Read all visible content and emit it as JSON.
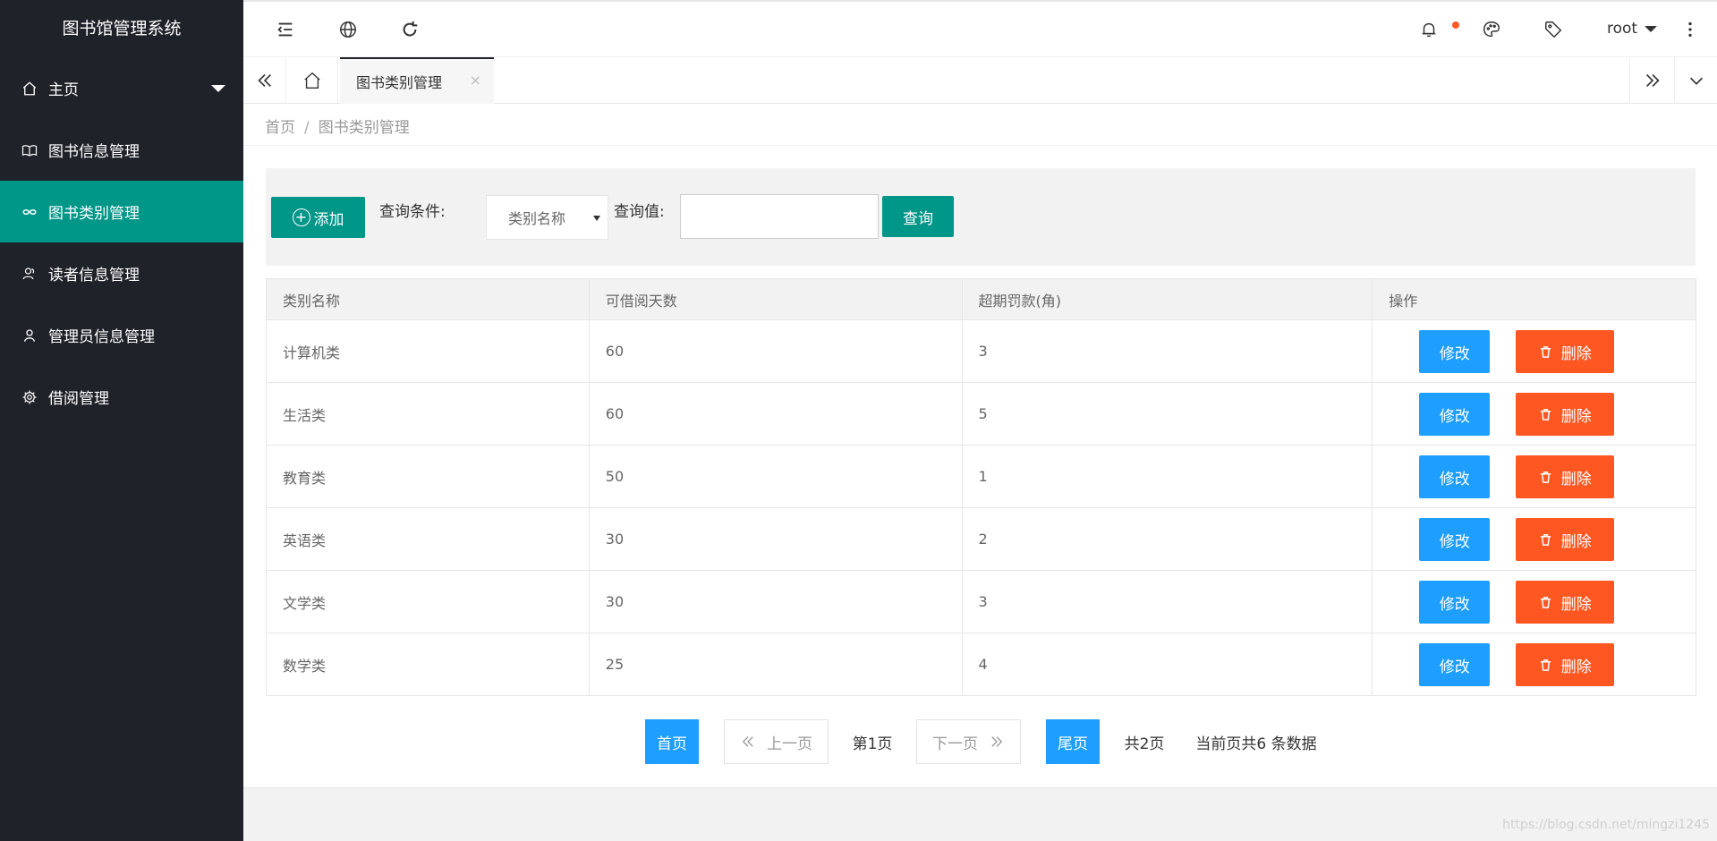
{
  "app": {
    "title": "图书馆管理系统"
  },
  "sidebar": {
    "items": [
      {
        "label": "主页",
        "icon": "home-icon"
      },
      {
        "label": "图书信息管理",
        "icon": "book-icon"
      },
      {
        "label": "图书类别管理",
        "icon": "link-icon"
      },
      {
        "label": "读者信息管理",
        "icon": "user-group-icon"
      },
      {
        "label": "管理员信息管理",
        "icon": "user-icon"
      },
      {
        "label": "借阅管理",
        "icon": "gear-icon"
      }
    ],
    "active_index": 2
  },
  "header": {
    "user": "root"
  },
  "tabs": {
    "active_label": "图书类别管理",
    "close_glyph": "×"
  },
  "breadcrumb": {
    "home": "首页",
    "separator": "/",
    "current": "图书类别管理"
  },
  "search": {
    "add_label": "添加",
    "add_plus": "+",
    "condition_label": "查询条件:",
    "condition_selected": "类别名称",
    "value_label": "查询值:",
    "value": "",
    "query_label": "查询"
  },
  "table": {
    "headers": [
      "类别名称",
      "可借阅天数",
      "超期罚款(角)",
      "操作"
    ],
    "rows": [
      {
        "name": "计算机类",
        "days": "60",
        "fine": "3"
      },
      {
        "name": "生活类",
        "days": "60",
        "fine": "5"
      },
      {
        "name": "教育类",
        "days": "50",
        "fine": "1"
      },
      {
        "name": "英语类",
        "days": "30",
        "fine": "2"
      },
      {
        "name": "文学类",
        "days": "30",
        "fine": "3"
      },
      {
        "name": "数学类",
        "days": "25",
        "fine": "4"
      }
    ],
    "edit_label": "修改",
    "delete_label": "删除"
  },
  "pagination": {
    "first": "首页",
    "prev": "上一页",
    "current": "第1页",
    "next": "下一页",
    "last": "尾页",
    "total_pages": "共2页",
    "summary": "当前页共6 条数据"
  },
  "colors": {
    "sidebar_bg": "#20222a",
    "accent": "#009688",
    "blue": "#1e9fff",
    "danger": "#ff5722"
  },
  "watermark": "https://blog.csdn.net/mingzi1245"
}
